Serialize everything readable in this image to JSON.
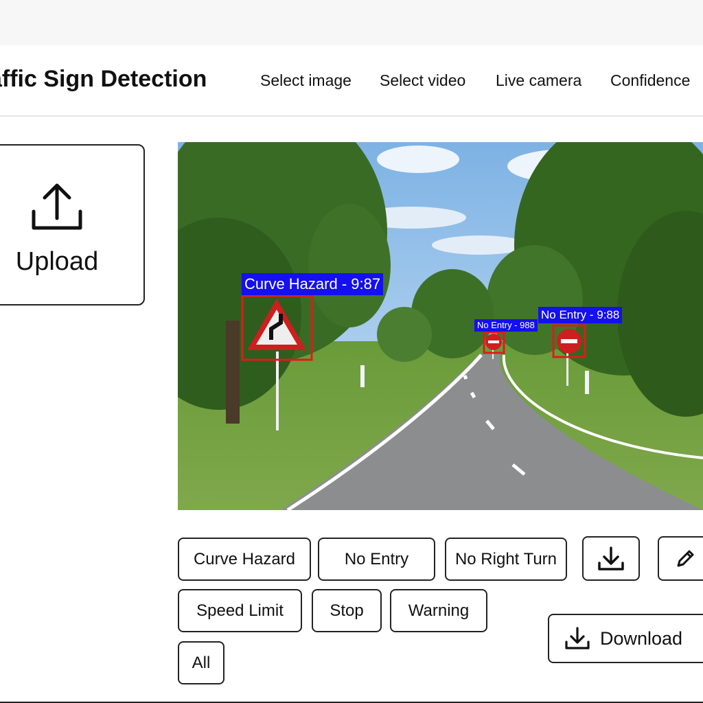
{
  "app": {
    "title": "affic Sign Detection"
  },
  "nav": [
    "Select image",
    "Select video",
    "Live camera",
    "Confidence"
  ],
  "upload": {
    "label": "Upload",
    "icon": "upload-icon"
  },
  "detections": [
    {
      "label": "Curve Hazard - 9:87",
      "sign": "curve-hazard-sign"
    },
    {
      "label": "No Entry - 988",
      "sign": "no-entry-sign"
    },
    {
      "label": "No Entry - 9:88",
      "sign": "no-entry-sign"
    }
  ],
  "filters": {
    "row1": [
      "Curve Hazard",
      "No Entry",
      "No Right Turn"
    ],
    "row2": [
      "Speed Limit",
      "Stop",
      "Warning"
    ],
    "row3": [
      "All"
    ]
  },
  "actions": {
    "download_icon": "download-icon",
    "edit_icon": "pencil-icon",
    "download_label": "Download"
  },
  "colors": {
    "detection_box": "#e01a1a",
    "detection_label_bg": "#1410ee"
  }
}
